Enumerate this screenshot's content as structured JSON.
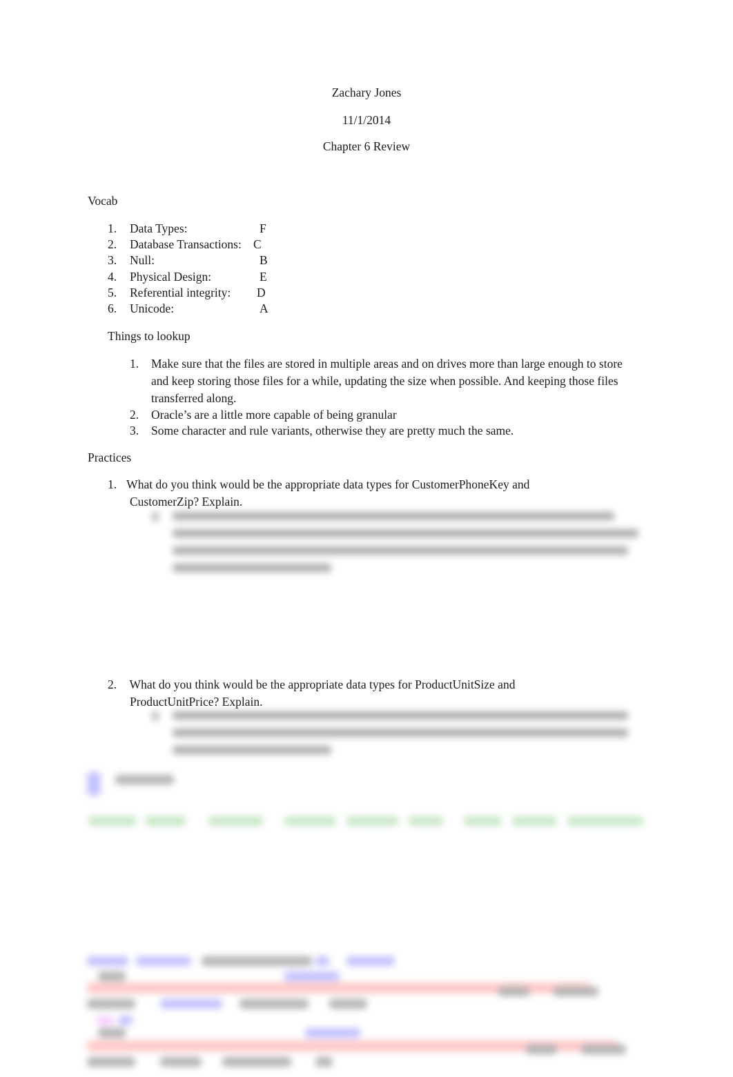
{
  "header": {
    "author": "Zachary Jones",
    "date": "11/1/2014",
    "title": "Chapter 6 Review"
  },
  "vocab": {
    "heading": "Vocab",
    "items": [
      {
        "num": "1.",
        "term": "Data Types:",
        "answer": "F"
      },
      {
        "num": "2.",
        "term": "Database Transactions:",
        "answer": "C"
      },
      {
        "num": "3.",
        "term": "Null:",
        "answer": "B"
      },
      {
        "num": "4.",
        "term": "Physical Design:",
        "answer": "E"
      },
      {
        "num": "5.",
        "term": "Referential integrity:",
        "answer": "D"
      },
      {
        "num": "6.",
        "term": "Unicode:",
        "answer": "A"
      }
    ]
  },
  "lookup": {
    "heading": "Things to lookup",
    "items": [
      {
        "num": "1.",
        "text": "Make sure that the files are stored in multiple areas and on drives more than large enough to store and keep storing those files for a while, updating the size when possible. And keeping those files transferred along."
      },
      {
        "num": "2.",
        "text": "Oracle’s are a little more capable of being granular"
      },
      {
        "num": "3.",
        "text": "Some character and rule variants, otherwise they are pretty much the same."
      }
    ]
  },
  "practices": {
    "heading": "Practices",
    "items": [
      {
        "num": "1.",
        "line1": " What do you think would be the appropriate data types for CustomerPhoneKey and",
        "line2": "CustomerZip? Explain."
      },
      {
        "num": "2.",
        "line1": "  What do you think would be the appropriate data types for ProductUnitSize and",
        "line2": "ProductUnitPrice? Explain."
      }
    ]
  },
  "colors": {
    "text": "#1a1a1a",
    "blur_green": "#9fd49a",
    "blur_blue": "#8f8fff",
    "blur_red": "#ff9a9a"
  }
}
